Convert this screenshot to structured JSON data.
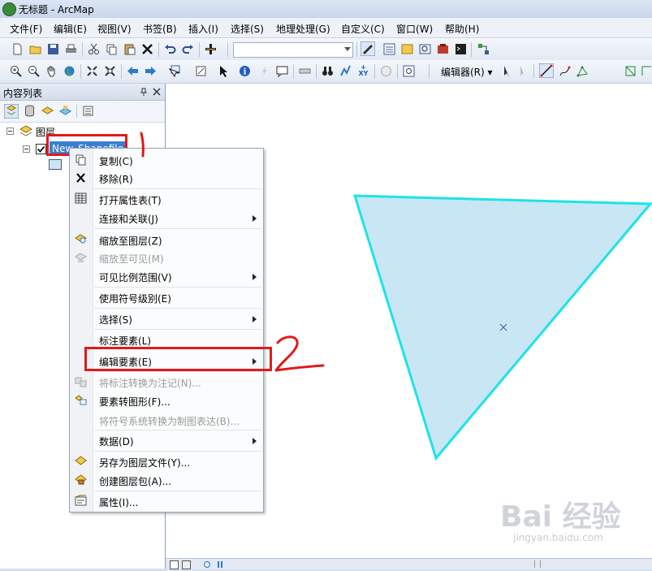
{
  "window": {
    "title": "无标题 - ArcMap"
  },
  "menubar": {
    "items": [
      "文件(F)",
      "编辑(E)",
      "视图(V)",
      "书签(B)",
      "插入(I)",
      "选择(S)",
      "地理处理(G)",
      "自定义(C)",
      "窗口(W)",
      "帮助(H)"
    ]
  },
  "toolbar": {
    "editor_label": "编辑器(R) ▾"
  },
  "toc": {
    "title": "内容列表",
    "layers_group": "图层",
    "layer_name": "New_Shapefile"
  },
  "context_menu": {
    "items": [
      {
        "label": "复制(C)",
        "icon": "copy-icon",
        "enabled": true,
        "submenu": false
      },
      {
        "label": "移除(R)",
        "icon": "remove-x-icon",
        "enabled": true,
        "submenu": false
      },
      {
        "label": "打开属性表(T)",
        "icon": "table-icon",
        "enabled": true,
        "submenu": false
      },
      {
        "label": "连接和关联(J)",
        "icon": "",
        "enabled": true,
        "submenu": true
      },
      {
        "label": "缩放至图层(Z)",
        "icon": "zoom-to-layer-icon",
        "enabled": true,
        "submenu": false
      },
      {
        "label": "缩放至可见(M)",
        "icon": "zoom-visible-icon",
        "enabled": false,
        "submenu": false
      },
      {
        "label": "可见比例范围(V)",
        "icon": "",
        "enabled": true,
        "submenu": true
      },
      {
        "label": "使用符号级别(E)",
        "icon": "",
        "enabled": true,
        "submenu": false
      },
      {
        "label": "选择(S)",
        "icon": "",
        "enabled": true,
        "submenu": true
      },
      {
        "label": "标注要素(L)",
        "icon": "",
        "enabled": true,
        "submenu": false
      },
      {
        "label": "编辑要素(E)",
        "icon": "",
        "enabled": true,
        "submenu": true
      },
      {
        "label": "将标注转换为注记(N)...",
        "icon": "convert-labels-icon",
        "enabled": false,
        "submenu": false
      },
      {
        "label": "要素转图形(F)...",
        "icon": "features-to-graphics-icon",
        "enabled": true,
        "submenu": false
      },
      {
        "label": "将符号系统转换为制图表达(B)...",
        "icon": "",
        "enabled": false,
        "submenu": false
      },
      {
        "label": "数据(D)",
        "icon": "",
        "enabled": true,
        "submenu": true
      },
      {
        "label": "另存为图层文件(Y)...",
        "icon": "save-layer-icon",
        "enabled": true,
        "submenu": false
      },
      {
        "label": "创建图层包(A)...",
        "icon": "layer-package-icon",
        "enabled": true,
        "submenu": false
      },
      {
        "label": "属性(I)...",
        "icon": "properties-icon",
        "enabled": true,
        "submenu": false
      }
    ]
  },
  "annotations": {
    "mark1": "1",
    "mark2": "2"
  },
  "watermark": {
    "brand": "Bai 经验",
    "url": "jingyan.baidu.com"
  },
  "colors": {
    "polygon_fill": "#c9e6f4",
    "polygon_outline": "#1de3e8",
    "annotation_red": "#e01a1a",
    "selection_blue": "#3a7fd0"
  }
}
